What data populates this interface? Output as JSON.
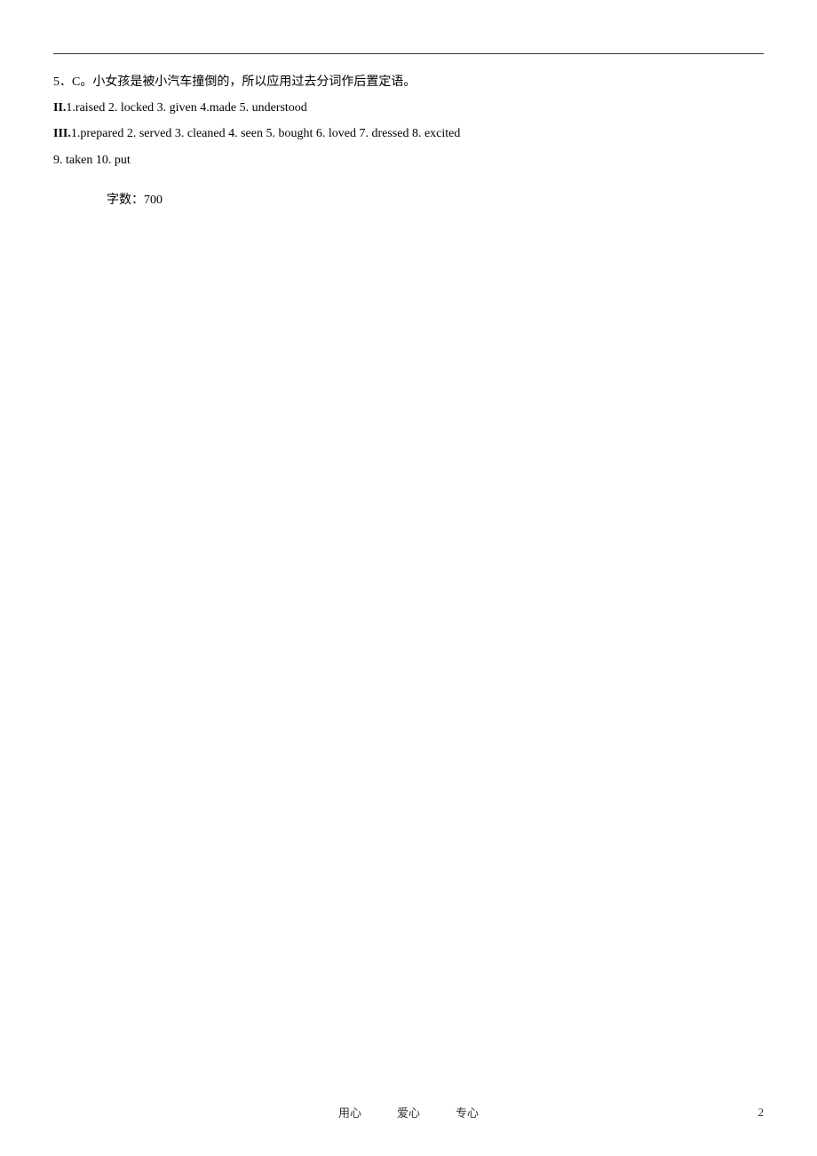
{
  "page": {
    "top_border": true,
    "section5": {
      "line1": "5．C。小女孩是被小汽车撞倒的，所以应用过去分词作后置定语。",
      "section_II_label": "II.",
      "section_II_items": "1.raised   2. locked       3. given   4.made   5. understood",
      "section_III_label": "III.",
      "section_III_items": "1.prepared   2. served   3. cleaned   4. seen   5. bought      6. loved      7. dressed   8. excited",
      "section_III_line2": "9. taken    10. put"
    },
    "word_count_label": "字数：",
    "word_count_value": "700",
    "footer": {
      "items": [
        "用心",
        "爱心",
        "专心"
      ],
      "page_number": "2"
    }
  }
}
